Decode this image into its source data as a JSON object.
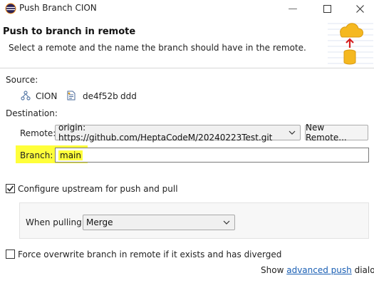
{
  "window": {
    "title": "Push Branch CION",
    "icon": "eclipse-app-icon"
  },
  "banner": {
    "title": "Push to branch in remote",
    "description": "Select a remote and the name the branch should have in the remote.",
    "art_icon": "cloud-push-icon"
  },
  "source": {
    "label": "Source:",
    "repo_name": "CION",
    "commit_id": "de4f52b",
    "commit_message": "ddd"
  },
  "destination": {
    "label": "Destination:",
    "remote_label": "Remote:",
    "remote_value": "origin: https://github.com/HeptaCodeM/20240223Test.git",
    "new_remote_button": "New Remote...",
    "branch_label": "Branch:",
    "branch_value": "main"
  },
  "upstream": {
    "checkbox_label": "Configure upstream for push and pull",
    "checked": true,
    "when_pulling_label": "When pulling:",
    "when_pulling_value": "Merge"
  },
  "force": {
    "checkbox_label": "Force overwrite branch in remote if it exists and has diverged",
    "checked": false
  },
  "footer": {
    "prefix": "Show",
    "link": "advanced push",
    "suffix": "dialog"
  },
  "colors": {
    "highlight": "#ffff3a",
    "link": "#1a5fb4",
    "cloud": "#f5b820"
  }
}
